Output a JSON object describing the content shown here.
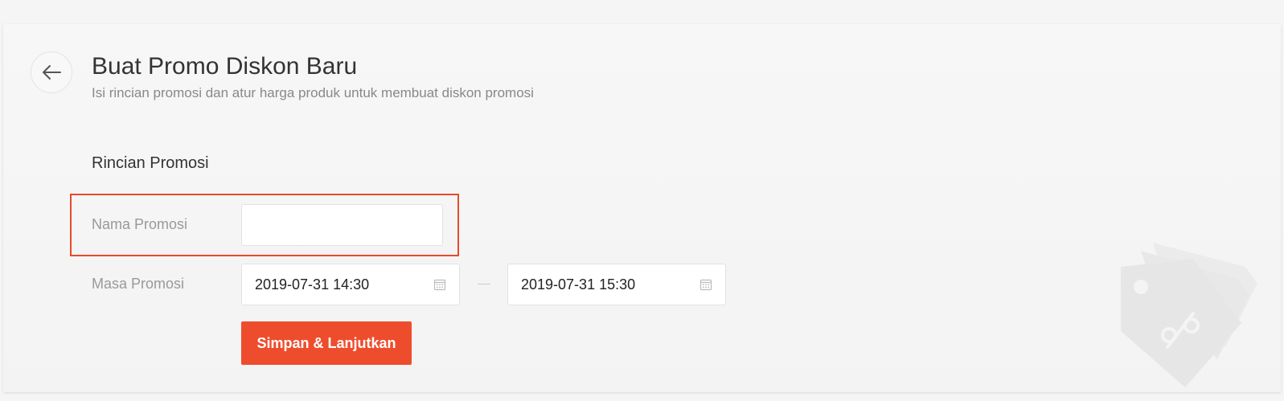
{
  "header": {
    "title": "Buat Promo Diskon Baru",
    "subtitle": "Isi rincian promosi dan atur harga produk untuk membuat diskon promosi"
  },
  "section": {
    "title": "Rincian Promosi"
  },
  "form": {
    "name_label": "Nama Promosi",
    "name_value": "",
    "period_label": "Masa Promosi",
    "start_date": "2019-07-31 14:30",
    "end_date": "2019-07-31 15:30"
  },
  "actions": {
    "submit_label": "Simpan & Lanjutkan"
  },
  "icons": {
    "back": "arrow-left-icon",
    "calendar": "calendar-icon",
    "illustration": "discount-tag-icon"
  },
  "colors": {
    "accent": "#ee4d2d",
    "highlight": "#e84a2a"
  }
}
